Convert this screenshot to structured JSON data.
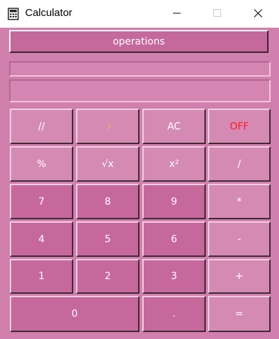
{
  "window": {
    "title": "Calculator",
    "icon": "calculator-icon",
    "controls": [
      "minimize-icon",
      "maximize-icon",
      "close-icon"
    ]
  },
  "operations_label": "operations",
  "display": {
    "history": "",
    "value": ""
  },
  "colors": {
    "background": "#d17fad",
    "button_dark": "#c7689d",
    "button_light": "#d58ab4",
    "moon": "#f2c230",
    "off": "#ff1a1a",
    "text": "#ffffff"
  },
  "keys": {
    "floordiv": "//",
    "moon": "☽",
    "ac": "AC",
    "off": "OFF",
    "percent": "%",
    "sqrt": "√x",
    "square": "x²",
    "divide": "/",
    "seven": "7",
    "eight": "8",
    "nine": "9",
    "multiply": "*",
    "four": "4",
    "five": "5",
    "six": "6",
    "minus": "-",
    "one": "1",
    "two": "2",
    "three": "3",
    "plus": "+",
    "zero": "0",
    "dot": ".",
    "equals": "="
  }
}
